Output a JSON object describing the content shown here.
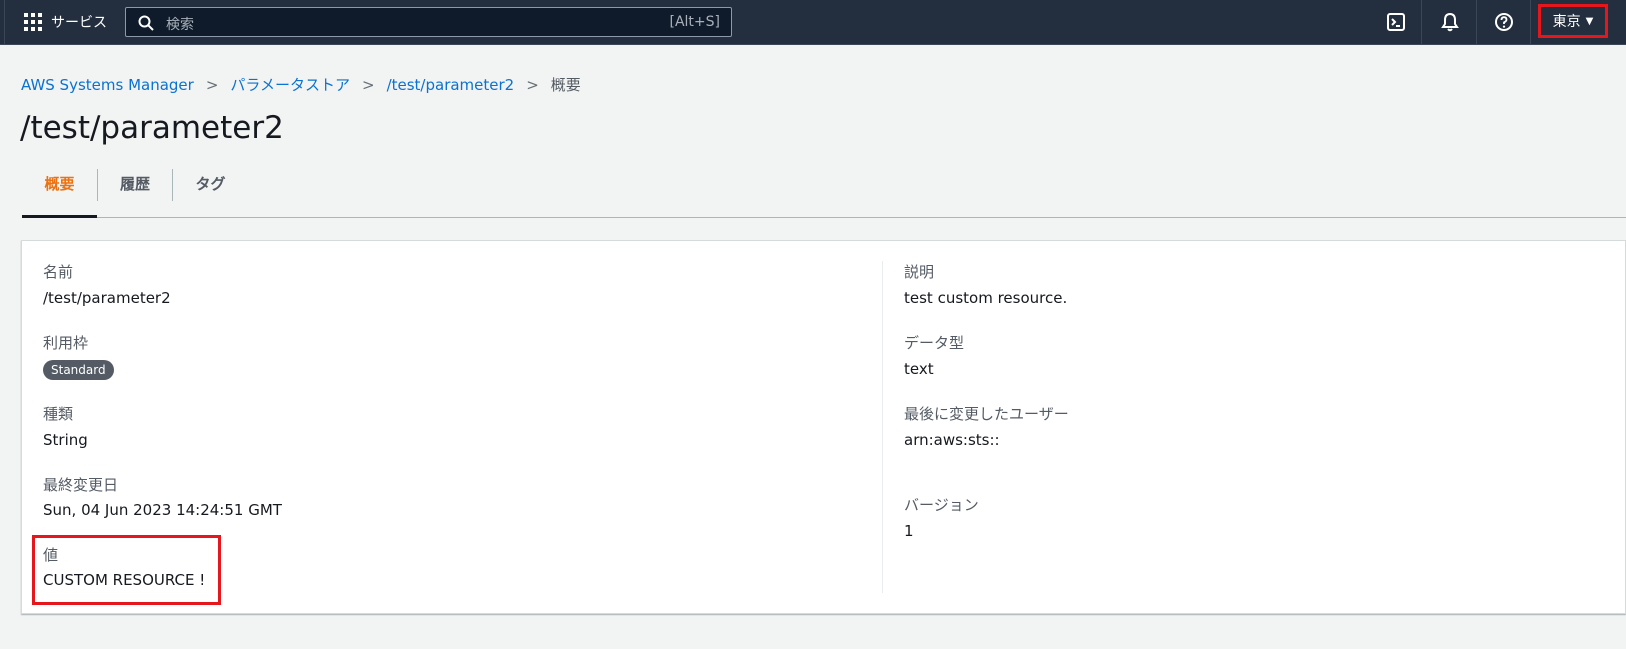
{
  "topnav": {
    "services_label": "サービス",
    "search_placeholder": "検索",
    "search_shortcut": "[Alt+S]",
    "region_label": "東京",
    "region_caret": "▼",
    "icons": [
      "grid-icon",
      "search-icon",
      "cloudshell-icon",
      "notifications-icon",
      "help-icon"
    ]
  },
  "breadcrumb": {
    "items": [
      "AWS Systems Manager",
      "パラメータストア",
      "/test/parameter2"
    ],
    "current": "概要",
    "separator": ">"
  },
  "page_title": "/test/parameter2",
  "tabs": [
    {
      "label": "概要",
      "active": true
    },
    {
      "label": "履歴",
      "active": false
    },
    {
      "label": "タグ",
      "active": false
    }
  ],
  "details": {
    "left": {
      "name_label": "名前",
      "name_value": "/test/parameter2",
      "tier_label": "利用枠",
      "tier_value": "Standard",
      "type_label": "種類",
      "type_value": "String",
      "lastmod_label": "最終変更日",
      "lastmod_value": "Sun, 04 Jun 2023 14:24:51 GMT",
      "value_label": "値",
      "value_value": "CUSTOM RESOURCE !"
    },
    "right": {
      "description_label": "説明",
      "description_value": "test custom resource.",
      "datatype_label": "データ型",
      "datatype_value": "text",
      "lastuser_label": "最後に変更したユーザー",
      "lastuser_value": "arn:aws:sts::",
      "version_label": "バージョン",
      "version_value": "1"
    }
  },
  "colors": {
    "nav_bg": "#232f3e",
    "link": "#0972d3",
    "active_tab": "#ec7211",
    "highlight": "#e5161c",
    "badge_bg": "#545b64"
  }
}
